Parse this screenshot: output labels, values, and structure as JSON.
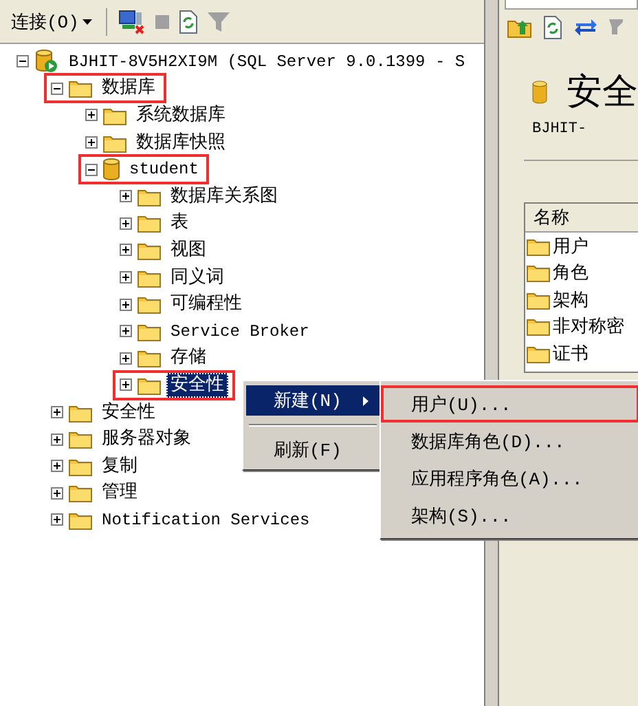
{
  "toolbar": {
    "connect_label": "连接(O)",
    "buttons": [
      {
        "kind": "disconnect",
        "disabled": false
      },
      {
        "kind": "stop",
        "disabled": true
      },
      {
        "kind": "refresh",
        "disabled": false
      },
      {
        "kind": "filter",
        "disabled": true
      }
    ]
  },
  "tree": [
    {
      "label": "BJHIT-8V5H2XI9M (SQL Server 9.0.1399 - S",
      "kind": "server",
      "expanded": true,
      "selected": false,
      "highlighted": false,
      "children": [
        {
          "label": "数据库",
          "kind": "folder",
          "expanded": true,
          "selected": false,
          "highlighted": true,
          "children": [
            {
              "label": "系统数据库",
              "kind": "folder",
              "expanded": false,
              "selected": false,
              "highlighted": false
            },
            {
              "label": "数据库快照",
              "kind": "folder",
              "expanded": false,
              "selected": false,
              "highlighted": false
            },
            {
              "label": "student",
              "kind": "database",
              "expanded": true,
              "selected": false,
              "highlighted": true,
              "children": [
                {
                  "label": "数据库关系图",
                  "kind": "folder",
                  "expanded": false,
                  "selected": false,
                  "highlighted": false
                },
                {
                  "label": "表",
                  "kind": "folder",
                  "expanded": false,
                  "selected": false,
                  "highlighted": false
                },
                {
                  "label": "视图",
                  "kind": "folder",
                  "expanded": false,
                  "selected": false,
                  "highlighted": false
                },
                {
                  "label": "同义词",
                  "kind": "folder",
                  "expanded": false,
                  "selected": false,
                  "highlighted": false
                },
                {
                  "label": "可编程性",
                  "kind": "folder",
                  "expanded": false,
                  "selected": false,
                  "highlighted": false
                },
                {
                  "label": "Service Broker",
                  "kind": "folder",
                  "expanded": false,
                  "selected": false,
                  "highlighted": false
                },
                {
                  "label": "存储",
                  "kind": "folder",
                  "expanded": false,
                  "selected": false,
                  "highlighted": false
                },
                {
                  "label": "安全性",
                  "kind": "folder",
                  "expanded": false,
                  "selected": true,
                  "highlighted": true
                }
              ]
            }
          ]
        },
        {
          "label": "安全性",
          "kind": "folder",
          "expanded": false,
          "selected": false,
          "highlighted": false
        },
        {
          "label": "服务器对象",
          "kind": "folder",
          "expanded": false,
          "selected": false,
          "highlighted": false
        },
        {
          "label": "复制",
          "kind": "folder",
          "expanded": false,
          "selected": false,
          "highlighted": false
        },
        {
          "label": "管理",
          "kind": "folder",
          "expanded": false,
          "selected": false,
          "highlighted": false
        },
        {
          "label": "Notification Services",
          "kind": "folder",
          "expanded": false,
          "selected": false,
          "highlighted": false
        }
      ]
    }
  ],
  "context_menu": {
    "items": [
      {
        "kind": "submenu",
        "label": "新建(N)",
        "selected": true
      },
      {
        "kind": "separator"
      },
      {
        "kind": "item",
        "label": "刷新(F)",
        "selected": false
      }
    ]
  },
  "submenu": {
    "items": [
      {
        "label": "用户(U)...",
        "highlighted": true
      },
      {
        "label": "数据库角色(D)...",
        "highlighted": false
      },
      {
        "label": "应用程序角色(A)...",
        "highlighted": false
      },
      {
        "label": "架构(S)...",
        "highlighted": false
      }
    ]
  },
  "details": {
    "title": "安全",
    "subtitle": "BJHIT-",
    "list": {
      "column": "名称",
      "items": [
        "用户",
        "角色",
        "架构",
        "非对称密",
        "证书"
      ]
    }
  }
}
